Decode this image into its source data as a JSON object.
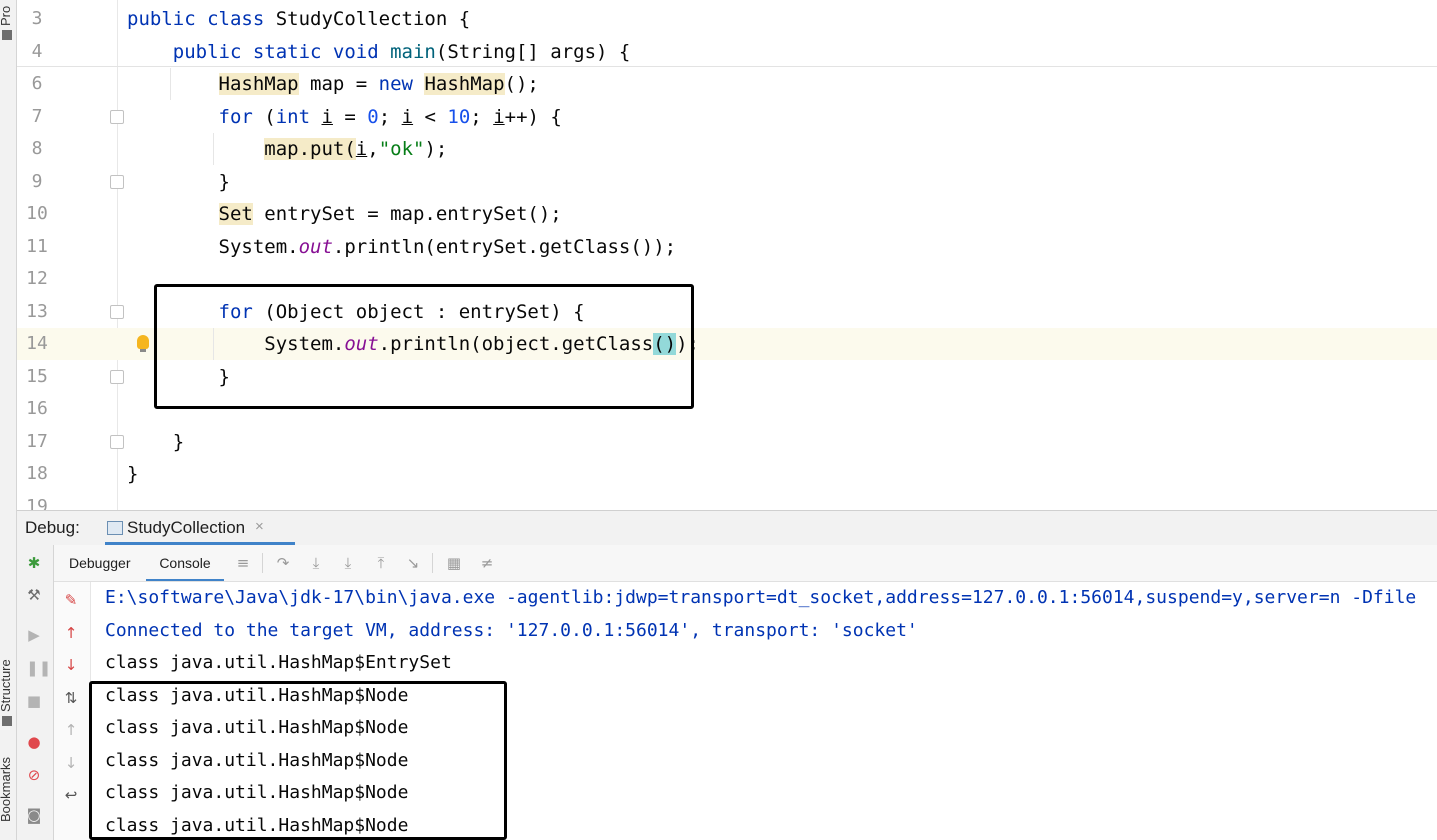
{
  "left_strip": {
    "project_label": "Pro",
    "structure_label": "Structure",
    "bookmarks_label": "Bookmarks"
  },
  "editor": {
    "lines": [
      {
        "num": "3",
        "tokens": [
          {
            "t": "public class ",
            "c": "kw"
          },
          {
            "t": "StudyCollection {",
            "c": ""
          }
        ]
      },
      {
        "num": "4",
        "tokens": [
          {
            "t": "    public static void ",
            "c": "kw"
          },
          {
            "t": "main",
            "c": "mtd"
          },
          {
            "t": "(String[] args) {",
            "c": ""
          }
        ]
      },
      {
        "num": "6",
        "tokens": [
          {
            "t": "        ",
            "c": ""
          },
          {
            "t": "HashMap",
            "c": "hl"
          },
          {
            "t": " map = ",
            "c": ""
          },
          {
            "t": "new ",
            "c": "kw"
          },
          {
            "t": "HashMap",
            "c": "hl"
          },
          {
            "t": "();",
            "c": ""
          }
        ]
      },
      {
        "num": "7",
        "tokens": [
          {
            "t": "        ",
            "c": ""
          },
          {
            "t": "for ",
            "c": "kw"
          },
          {
            "t": "(",
            "c": ""
          },
          {
            "t": "int ",
            "c": "kw"
          },
          {
            "t": "i",
            "c": "ul"
          },
          {
            "t": " = ",
            "c": ""
          },
          {
            "t": "0",
            "c": "num"
          },
          {
            "t": "; ",
            "c": ""
          },
          {
            "t": "i",
            "c": "ul"
          },
          {
            "t": " < ",
            "c": ""
          },
          {
            "t": "10",
            "c": "num"
          },
          {
            "t": "; ",
            "c": ""
          },
          {
            "t": "i",
            "c": "ul"
          },
          {
            "t": "++) {",
            "c": ""
          }
        ]
      },
      {
        "num": "8",
        "tokens": [
          {
            "t": "            ",
            "c": ""
          },
          {
            "t": "map.put(",
            "c": "hl"
          },
          {
            "t": "i",
            "c": "ul"
          },
          {
            "t": ",",
            "c": ""
          },
          {
            "t": "\"ok\"",
            "c": "str"
          },
          {
            "t": ");",
            "c": ""
          }
        ]
      },
      {
        "num": "9",
        "tokens": [
          {
            "t": "        }",
            "c": ""
          }
        ]
      },
      {
        "num": "10",
        "tokens": [
          {
            "t": "        ",
            "c": ""
          },
          {
            "t": "Set",
            "c": "hl"
          },
          {
            "t": " entrySet = map.entrySet();",
            "c": ""
          }
        ]
      },
      {
        "num": "11",
        "tokens": [
          {
            "t": "        System.",
            "c": ""
          },
          {
            "t": "out",
            "c": "fld"
          },
          {
            "t": ".println(entrySet.getClass());",
            "c": ""
          }
        ]
      },
      {
        "num": "12",
        "tokens": []
      },
      {
        "num": "13",
        "tokens": [
          {
            "t": "        ",
            "c": ""
          },
          {
            "t": "for ",
            "c": "kw"
          },
          {
            "t": "(Object object : entrySet) {",
            "c": ""
          }
        ]
      },
      {
        "num": "14",
        "tokens": [
          {
            "t": "            System.",
            "c": ""
          },
          {
            "t": "out",
            "c": "fld"
          },
          {
            "t": ".println(object.getClass",
            "c": ""
          },
          {
            "t": "()",
            "c": "brace-hl"
          },
          {
            "t": ");",
            "c": ""
          }
        ],
        "current": true
      },
      {
        "num": "15",
        "tokens": [
          {
            "t": "        }",
            "c": ""
          }
        ]
      },
      {
        "num": "16",
        "tokens": []
      },
      {
        "num": "17",
        "tokens": [
          {
            "t": "    }",
            "c": ""
          }
        ]
      },
      {
        "num": "18",
        "tokens": [
          {
            "t": "}",
            "c": ""
          }
        ]
      },
      {
        "num": "19",
        "tokens": []
      }
    ]
  },
  "debug": {
    "label": "Debug:",
    "session_tab": "StudyCollection",
    "close_glyph": "×",
    "tabs": {
      "debugger": "Debugger",
      "console": "Console"
    }
  },
  "console": {
    "lines": [
      {
        "text": "E:\\software\\Java\\jdk-17\\bin\\java.exe -agentlib:jdwp=transport=dt_socket,address=127.0.0.1:56014,suspend=y,server=n -Dfile",
        "sys": true
      },
      {
        "text": "Connected to the target VM, address: '127.0.0.1:56014', transport: 'socket'",
        "sys": true
      },
      {
        "text": "class java.util.HashMap$EntrySet",
        "sys": false
      },
      {
        "text": "class java.util.HashMap$Node",
        "sys": false
      },
      {
        "text": "class java.util.HashMap$Node",
        "sys": false
      },
      {
        "text": "class java.util.HashMap$Node",
        "sys": false
      },
      {
        "text": "class java.util.HashMap$Node",
        "sys": false
      },
      {
        "text": "class java.util.HashMap$Node",
        "sys": false
      }
    ]
  },
  "icons": {
    "bug": "bug-icon",
    "wrench": "wrench-icon",
    "resume": "resume-icon",
    "pause": "pause-icon",
    "stop": "stop-icon",
    "breakpoints": "view-breakpoints-icon",
    "mute": "mute-breakpoints-icon",
    "camera": "camera-icon"
  }
}
